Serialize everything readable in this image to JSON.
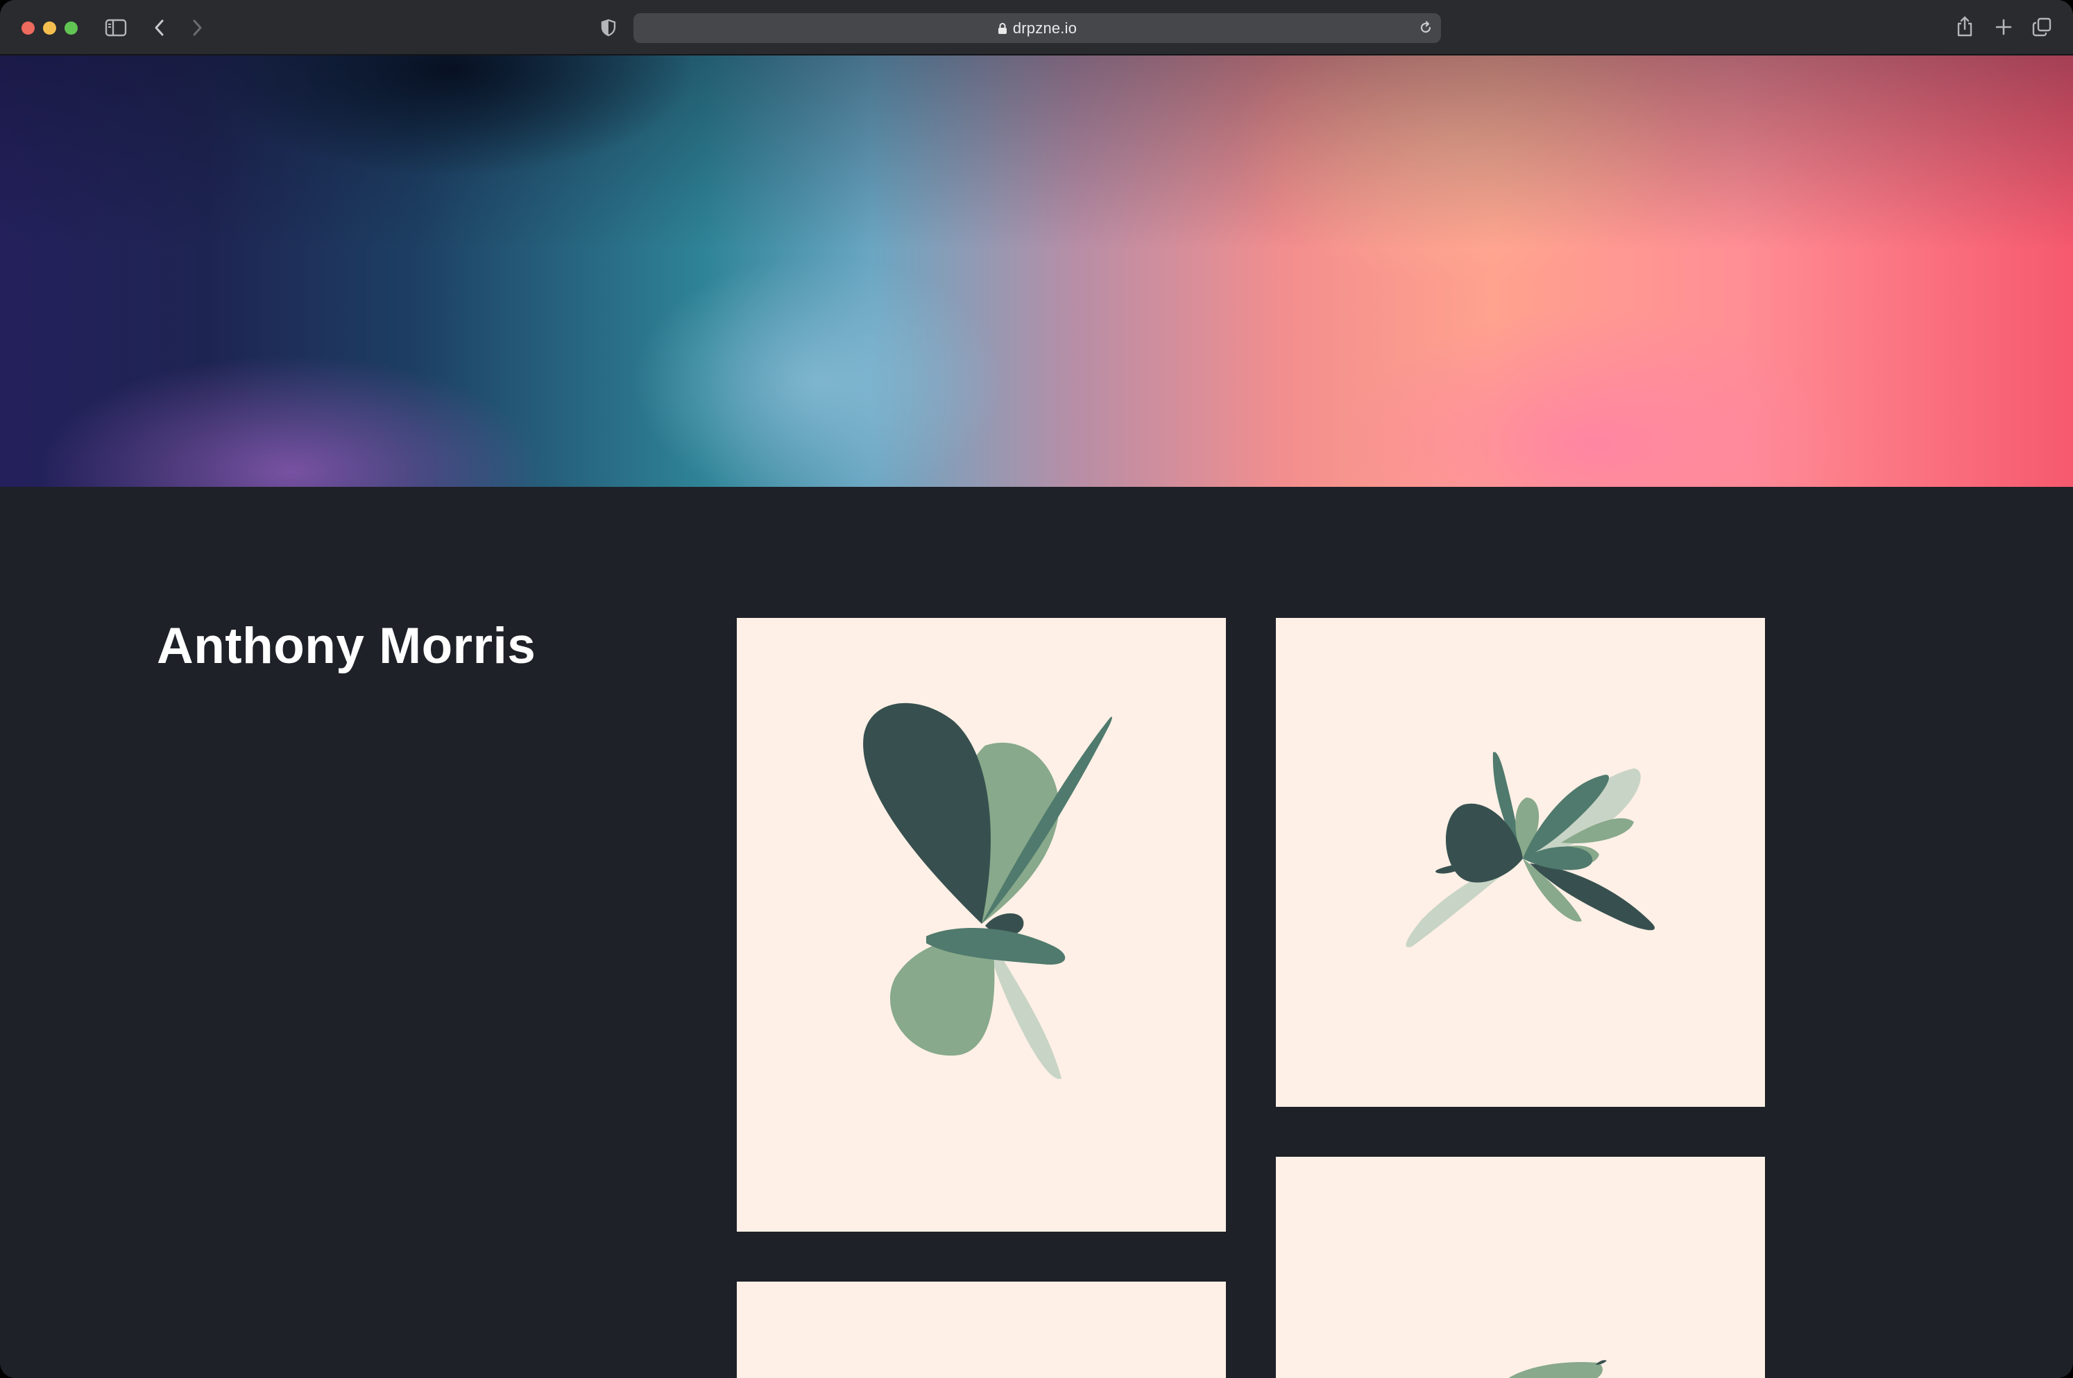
{
  "browser": {
    "url": "drpzne.io",
    "icons": {
      "sidebar": "sidebar-icon",
      "back": "chevron-left-icon",
      "forward": "chevron-right-icon",
      "privacy": "shield-icon",
      "lock": "lock-icon",
      "reload": "reload-icon",
      "share": "share-icon",
      "new_tab": "plus-icon",
      "tabs": "tabs-overview-icon"
    }
  },
  "hero": {
    "colors": [
      "#24205c",
      "#2f8497",
      "#6aa6c2",
      "#ffa28e",
      "#f6596e"
    ]
  },
  "profile": {
    "name": "Anthony Morris"
  },
  "gallery": {
    "card_background": "#fef0e6",
    "leaf_colors": [
      "#37504f",
      "#88a98b",
      "#4f7a6d",
      "#c8d4c6"
    ],
    "items": [
      {
        "name": "artwork-1"
      },
      {
        "name": "artwork-2"
      },
      {
        "name": "artwork-3"
      },
      {
        "name": "artwork-4"
      }
    ]
  }
}
